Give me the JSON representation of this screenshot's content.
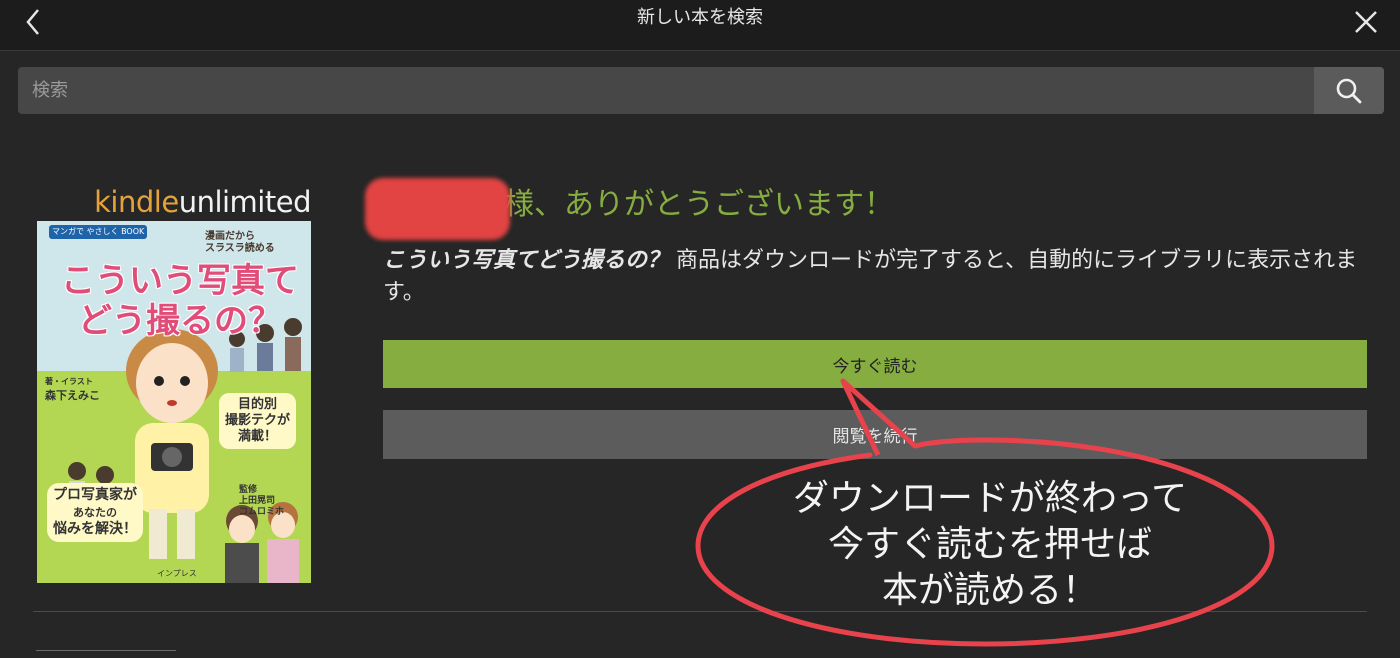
{
  "header": {
    "title": "新しい本を検索"
  },
  "search": {
    "placeholder": "検索"
  },
  "cover": {
    "badge_part1": "kindle",
    "badge_part2": "unlimited",
    "series": "マンガで やさしく BOOK",
    "subtitle_line1": "漫画だから",
    "subtitle_line2": "スラスラ読める",
    "title_line1": "こういう写真て",
    "title_line2": "どう撮るの？",
    "author_role": "著・イラスト",
    "author": "森下えみこ",
    "bubble1_line1": "目的別",
    "bubble1_line2": "撮影テクが",
    "bubble1_line3": "満載！",
    "bubble2_line1": "プロ写真家が",
    "bubble2_line2": "あなたの",
    "bubble2_line3": "悩みを解決！",
    "supervisor_role": "監修",
    "supervisor1": "上田晃司",
    "supervisor2": "コムロミホ",
    "publisher": "インプレス"
  },
  "main": {
    "thanks_suffix": "様、ありがとうございます！",
    "book_title": "こういう写真てどう撮るの？",
    "message_rest": " 商品はダウンロードが完了すると、自動的にライブラリに表示されます。",
    "read_now_label": "今すぐ読む",
    "continue_label": "閲覧を続行"
  },
  "annotation": {
    "line1": "ダウンロードが終わって",
    "line2": "今すぐ読むを押せば",
    "line3": "本が読める！",
    "color": "#e8434c"
  },
  "colors": {
    "accent_green": "#86ad3f",
    "background": "#262626"
  }
}
